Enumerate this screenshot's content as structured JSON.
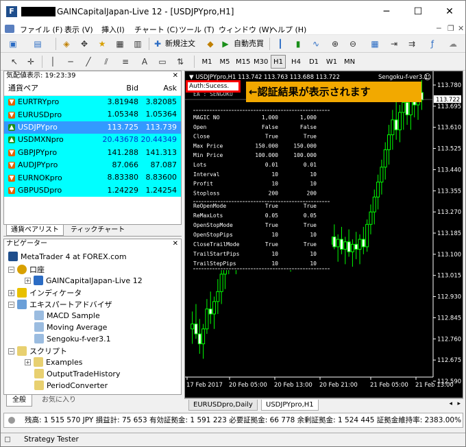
{
  "window": {
    "title": "GAINCapitalJapan-Live 12 - [USDJPYpro,H1]",
    "minimize": "─",
    "maximize": "☐",
    "close": "✕"
  },
  "menu": [
    "ファイル (F)",
    "表示 (V)",
    "挿入(I)",
    "チャート (C)",
    "ツール (T)",
    "ウィンドウ (W)",
    "ヘルプ (H)"
  ],
  "toolbar": {
    "new_order": "新規注文",
    "auto_trade": "自動売買",
    "timeframes": [
      "M1",
      "M5",
      "M15",
      "M30",
      "H1",
      "H4",
      "D1",
      "W1",
      "MN"
    ],
    "active_tf": "H1"
  },
  "market_watch": {
    "title": "気配値表示: 19:23:39",
    "headers": [
      "通貨ペア",
      "Bid",
      "Ask"
    ],
    "rows": [
      {
        "symbol": "EURTRYpro",
        "bid": "3.81948",
        "ask": "3.82085",
        "dir": "down"
      },
      {
        "symbol": "EURUSDpro",
        "bid": "1.05348",
        "ask": "1.05364",
        "dir": "down"
      },
      {
        "symbol": "USDJPYpro",
        "bid": "113.725",
        "ask": "113.739",
        "dir": "up"
      },
      {
        "symbol": "USDMXNpro",
        "bid": "20.43678",
        "ask": "20.44349",
        "dir": "up"
      },
      {
        "symbol": "GBPJPYpro",
        "bid": "141.288",
        "ask": "141.313",
        "dir": "down"
      },
      {
        "symbol": "AUDJPYpro",
        "bid": "87.066",
        "ask": "87.087",
        "dir": "down"
      },
      {
        "symbol": "EURNOKpro",
        "bid": "8.83380",
        "ask": "8.83600",
        "dir": "down"
      },
      {
        "symbol": "GBPUSDpro",
        "bid": "1.24229",
        "ask": "1.24254",
        "dir": "down"
      }
    ],
    "tabs": [
      "通貨ペアリスト",
      "ティックチャート"
    ]
  },
  "navigator": {
    "title": "ナビゲーター",
    "root": "MetaTrader 4 at FOREX.com",
    "accounts": "口座",
    "account": "GAINCapitalJapan-Live 12",
    "indicators": "インディケータ",
    "experts": "エキスパートアドバイザ",
    "expert_items": [
      "MACD Sample",
      "Moving Average",
      "Sengoku-f-ver3.1"
    ],
    "scripts": "スクリプト",
    "script_items": [
      "Examples",
      "OutputTradeHistory",
      "PeriodConverter"
    ],
    "tabs": [
      "全般",
      "お気に入り"
    ]
  },
  "chart": {
    "header": "USDJPYpro,H1  113.742 113.763 113.688 113.722",
    "ea": "Sengoku-f-ver3.1",
    "ea_line": "EA : SENGOKU",
    "auth": "Auth:Sucess.",
    "callout": "←認証結果が表示されます",
    "params": [
      [
        "MAGIC NO",
        "1,000",
        "1,000"
      ],
      [
        "Open",
        "False",
        "False"
      ],
      [
        "Close",
        "True",
        "True"
      ],
      [
        "Max Price",
        "150.000",
        "150.000"
      ],
      [
        "Min Price",
        "100.000",
        "100.000"
      ],
      [
        "Lots",
        "0.01",
        "0.01"
      ],
      [
        "Interval",
        "10",
        "10"
      ],
      [
        "Profit",
        "10",
        "10"
      ],
      [
        "Stoploss",
        "200",
        "200"
      ]
    ],
    "params2": [
      [
        "ReOpenMode",
        "True",
        "True"
      ],
      [
        "ReMaxLots",
        "0.05",
        "0.05"
      ],
      [
        "OpenStopMode",
        "True",
        "True"
      ],
      [
        "OpenStopPips",
        "10",
        "10"
      ],
      [
        "CloseTrailMode",
        "True",
        "True"
      ],
      [
        "TrailStartPips",
        "10",
        "10"
      ],
      [
        "TrailStepPips",
        "10",
        "10"
      ]
    ],
    "price_labels": [
      "113.780",
      "113.695",
      "113.610",
      "113.525",
      "113.440",
      "113.355",
      "113.270",
      "113.185",
      "113.100",
      "113.015",
      "112.930",
      "112.845",
      "112.760",
      "112.675",
      "112.590"
    ],
    "current_price": "113.722",
    "time_labels": [
      "17 Feb 2017",
      "20 Feb 05:00",
      "20 Feb 13:00",
      "20 Feb 21:00",
      "21 Feb 05:00",
      "21 Feb 13:00"
    ],
    "tabs": [
      "EURUSDpro,Daily",
      "USDJPYpro,H1"
    ]
  },
  "status": "残高: 1 515 570 JPY  損益計: 75 653  有効証拠金: 1 591 223  必要証拠金: 66 778  余剰証拠金: 1 524 445  証拠金維持率: 2383.00%",
  "strategy_tester": "Strategy Tester",
  "candles": [
    {
      "o": 112.8,
      "h": 112.87,
      "l": 112.74,
      "c": 112.82
    },
    {
      "o": 112.82,
      "h": 112.9,
      "l": 112.76,
      "c": 112.78
    },
    {
      "o": 112.78,
      "h": 112.84,
      "l": 112.7,
      "c": 112.74
    },
    {
      "o": 112.74,
      "h": 112.82,
      "l": 112.68,
      "c": 112.8
    },
    {
      "o": 112.8,
      "h": 112.92,
      "l": 112.78,
      "c": 112.88
    },
    {
      "o": 112.88,
      "h": 112.95,
      "l": 112.82,
      "c": 112.86
    },
    {
      "o": 112.86,
      "h": 112.93,
      "l": 112.8,
      "c": 112.91
    },
    {
      "o": 112.91,
      "h": 113.0,
      "l": 112.86,
      "c": 112.95
    },
    {
      "o": 112.95,
      "h": 113.05,
      "l": 112.9,
      "c": 113.02
    },
    {
      "o": 113.02,
      "h": 113.1,
      "l": 112.96,
      "c": 113.06
    },
    {
      "o": 113.06,
      "h": 113.14,
      "l": 113.02,
      "c": 113.1
    },
    {
      "o": 113.1,
      "h": 113.16,
      "l": 113.04,
      "c": 113.08
    },
    {
      "o": 113.08,
      "h": 113.14,
      "l": 113.02,
      "c": 113.12
    },
    {
      "o": 113.12,
      "h": 113.2,
      "l": 113.08,
      "c": 113.16
    },
    {
      "o": 113.16,
      "h": 113.22,
      "l": 113.1,
      "c": 113.14
    },
    {
      "o": 113.14,
      "h": 113.2,
      "l": 113.08,
      "c": 113.18
    },
    {
      "o": 113.18,
      "h": 113.24,
      "l": 113.12,
      "c": 113.15
    },
    {
      "o": 113.15,
      "h": 113.2,
      "l": 113.1,
      "c": 113.17
    },
    {
      "o": 113.17,
      "h": 113.22,
      "l": 113.11,
      "c": 113.13
    },
    {
      "o": 113.13,
      "h": 113.19,
      "l": 113.08,
      "c": 113.16
    },
    {
      "o": 113.16,
      "h": 113.21,
      "l": 113.1,
      "c": 113.12
    },
    {
      "o": 113.12,
      "h": 113.18,
      "l": 113.06,
      "c": 113.15
    },
    {
      "o": 113.15,
      "h": 113.2,
      "l": 113.09,
      "c": 113.11
    },
    {
      "o": 113.11,
      "h": 113.17,
      "l": 113.05,
      "c": 113.14
    },
    {
      "o": 113.14,
      "h": 113.19,
      "l": 113.08,
      "c": 113.1
    },
    {
      "o": 113.1,
      "h": 113.16,
      "l": 113.04,
      "c": 113.13
    },
    {
      "o": 113.13,
      "h": 113.18,
      "l": 113.07,
      "c": 113.09
    },
    {
      "o": 113.09,
      "h": 113.15,
      "l": 113.03,
      "c": 113.12
    },
    {
      "o": 113.12,
      "h": 113.17,
      "l": 113.06,
      "c": 113.15
    },
    {
      "o": 113.15,
      "h": 113.21,
      "l": 113.1,
      "c": 113.11
    },
    {
      "o": 113.11,
      "h": 113.16,
      "l": 113.05,
      "c": 113.14
    },
    {
      "o": 113.14,
      "h": 113.2,
      "l": 113.09,
      "c": 113.1
    },
    {
      "o": 113.1,
      "h": 113.15,
      "l": 113.04,
      "c": 113.13
    },
    {
      "o": 113.13,
      "h": 113.18,
      "l": 113.07,
      "c": 113.16
    },
    {
      "o": 113.16,
      "h": 113.22,
      "l": 113.11,
      "c": 113.12
    },
    {
      "o": 113.12,
      "h": 113.17,
      "l": 113.06,
      "c": 113.15
    },
    {
      "o": 113.15,
      "h": 113.2,
      "l": 113.09,
      "c": 113.11
    },
    {
      "o": 113.11,
      "h": 113.16,
      "l": 113.05,
      "c": 113.14
    },
    {
      "o": 113.14,
      "h": 113.19,
      "l": 113.08,
      "c": 113.17
    },
    {
      "o": 113.17,
      "h": 113.22,
      "l": 113.12,
      "c": 113.13
    },
    {
      "o": 113.13,
      "h": 113.18,
      "l": 113.07,
      "c": 113.16
    },
    {
      "o": 113.16,
      "h": 113.21,
      "l": 113.1,
      "c": 113.12
    },
    {
      "o": 113.12,
      "h": 113.17,
      "l": 113.06,
      "c": 113.15
    },
    {
      "o": 113.15,
      "h": 113.2,
      "l": 113.09,
      "c": 113.11
    },
    {
      "o": 113.11,
      "h": 113.16,
      "l": 113.05,
      "c": 113.14
    },
    {
      "o": 113.14,
      "h": 113.19,
      "l": 113.08,
      "c": 113.12
    },
    {
      "o": 113.12,
      "h": 113.18,
      "l": 113.06,
      "c": 113.16
    },
    {
      "o": 113.16,
      "h": 113.21,
      "l": 113.1,
      "c": 113.13
    },
    {
      "o": 113.13,
      "h": 113.24,
      "l": 113.11,
      "c": 113.22
    },
    {
      "o": 113.22,
      "h": 113.3,
      "l": 113.18,
      "c": 113.27
    },
    {
      "o": 113.27,
      "h": 113.36,
      "l": 113.22,
      "c": 113.33
    },
    {
      "o": 113.33,
      "h": 113.42,
      "l": 113.28,
      "c": 113.39
    },
    {
      "o": 113.39,
      "h": 113.48,
      "l": 113.34,
      "c": 113.45
    },
    {
      "o": 113.45,
      "h": 113.55,
      "l": 113.4,
      "c": 113.52
    },
    {
      "o": 113.52,
      "h": 113.62,
      "l": 113.46,
      "c": 113.58
    },
    {
      "o": 113.58,
      "h": 113.68,
      "l": 113.52,
      "c": 113.64
    },
    {
      "o": 113.64,
      "h": 113.72,
      "l": 113.56,
      "c": 113.6
    },
    {
      "o": 113.6,
      "h": 113.7,
      "l": 113.55,
      "c": 113.67
    },
    {
      "o": 113.67,
      "h": 113.76,
      "l": 113.6,
      "c": 113.71
    },
    {
      "o": 113.71,
      "h": 113.78,
      "l": 113.62,
      "c": 113.66
    },
    {
      "o": 113.66,
      "h": 113.75,
      "l": 113.6,
      "c": 113.74
    },
    {
      "o": 113.74,
      "h": 113.79,
      "l": 113.65,
      "c": 113.7
    },
    {
      "o": 113.7,
      "h": 113.77,
      "l": 113.64,
      "c": 113.75
    },
    {
      "o": 113.75,
      "h": 113.8,
      "l": 113.68,
      "c": 113.72
    }
  ]
}
